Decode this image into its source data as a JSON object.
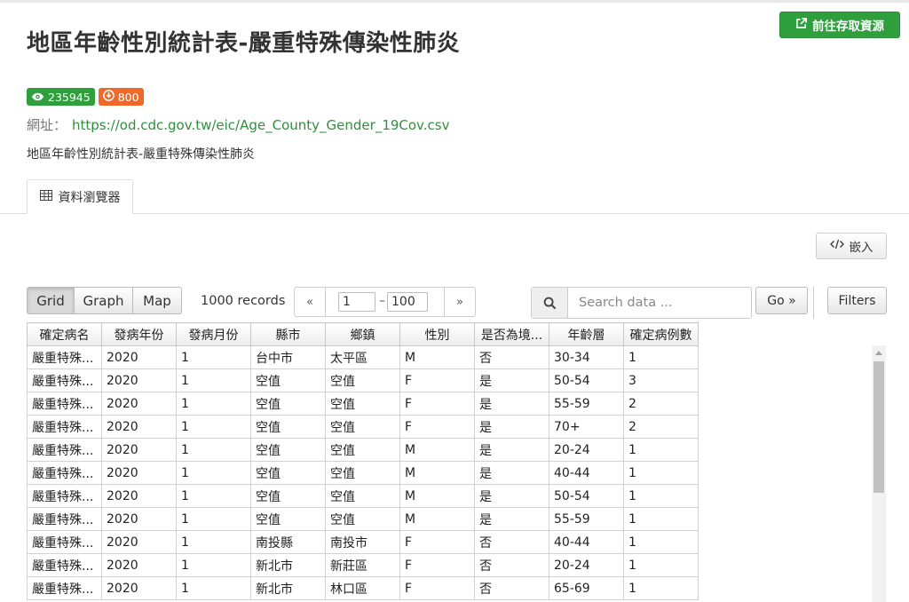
{
  "page": {
    "title": "地區年齡性別統計表-嚴重特殊傳染性肺炎",
    "goto_button": "前往存取資源",
    "views": "235945",
    "downloads": "800",
    "url_label": "網址：",
    "url": "https://od.cdc.gov.tw/eic/Age_County_Gender_19Cov.csv",
    "description": "地區年齡性別統計表-嚴重特殊傳染性肺炎",
    "tab_label": "資料瀏覽器",
    "embed_button": "嵌入"
  },
  "toolbar": {
    "views": [
      "Grid",
      "Graph",
      "Map"
    ],
    "active_view": "Grid",
    "records": "1000 records",
    "pager_prev": "«",
    "pager_next": "»",
    "from": "1",
    "dash": "–",
    "to": "100",
    "search_placeholder": "Search data ...",
    "go_button": "Go »",
    "filters_button": "Filters"
  },
  "grid": {
    "columns": [
      "確定病名",
      "發病年份",
      "發病月份",
      "縣市",
      "鄉鎮",
      "性別",
      "是否為境...",
      "年齡層",
      "確定病例數"
    ],
    "rows": [
      [
        "嚴重特殊...",
        "2020",
        "1",
        "台中市",
        "太平區",
        "M",
        "否",
        "30-34",
        "1"
      ],
      [
        "嚴重特殊...",
        "2020",
        "1",
        "空值",
        "空值",
        "F",
        "是",
        "50-54",
        "3"
      ],
      [
        "嚴重特殊...",
        "2020",
        "1",
        "空值",
        "空值",
        "F",
        "是",
        "55-59",
        "2"
      ],
      [
        "嚴重特殊...",
        "2020",
        "1",
        "空值",
        "空值",
        "F",
        "是",
        "70+",
        "2"
      ],
      [
        "嚴重特殊...",
        "2020",
        "1",
        "空值",
        "空值",
        "M",
        "是",
        "20-24",
        "1"
      ],
      [
        "嚴重特殊...",
        "2020",
        "1",
        "空值",
        "空值",
        "M",
        "是",
        "40-44",
        "1"
      ],
      [
        "嚴重特殊...",
        "2020",
        "1",
        "空值",
        "空值",
        "M",
        "是",
        "50-54",
        "1"
      ],
      [
        "嚴重特殊...",
        "2020",
        "1",
        "空值",
        "空值",
        "M",
        "是",
        "55-59",
        "1"
      ],
      [
        "嚴重特殊...",
        "2020",
        "1",
        "南投縣",
        "南投市",
        "F",
        "否",
        "40-44",
        "1"
      ],
      [
        "嚴重特殊...",
        "2020",
        "1",
        "新北市",
        "新莊區",
        "F",
        "否",
        "20-24",
        "1"
      ],
      [
        "嚴重特殊...",
        "2020",
        "1",
        "新北市",
        "林口區",
        "F",
        "否",
        "65-69",
        "1"
      ]
    ]
  },
  "colors": {
    "accent_green": "#2f9f3e",
    "link_green": "#2f8f3e",
    "download_orange": "#ee6a2a"
  },
  "icons": {
    "goto": "external-link-icon",
    "views": "eye-icon",
    "downloads": "download-circle-icon",
    "tab": "table-icon",
    "embed": "code-icon",
    "search": "search-icon"
  }
}
